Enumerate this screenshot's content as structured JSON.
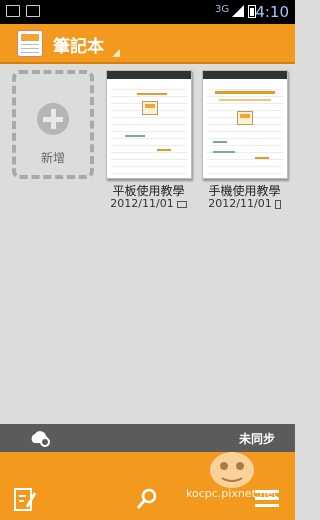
{
  "status_bar": {
    "network": "3G",
    "time": "4:10"
  },
  "action_bar": {
    "title": "筆記本"
  },
  "new_card": {
    "label": "新增"
  },
  "notes": [
    {
      "title": "平板使用教學",
      "date": "2012/11/01",
      "device": "tablet-icon"
    },
    {
      "title": "手機使用教學",
      "date": "2012/11/01",
      "device": "phone-icon"
    }
  ],
  "sync_bar": {
    "label": "未同步"
  },
  "watermark": {
    "text": "kocpc.pixnet.net"
  },
  "colors": {
    "accent": "#f39a1e",
    "background": "#dcdcdc",
    "sync_bar": "#5b5b5b"
  }
}
